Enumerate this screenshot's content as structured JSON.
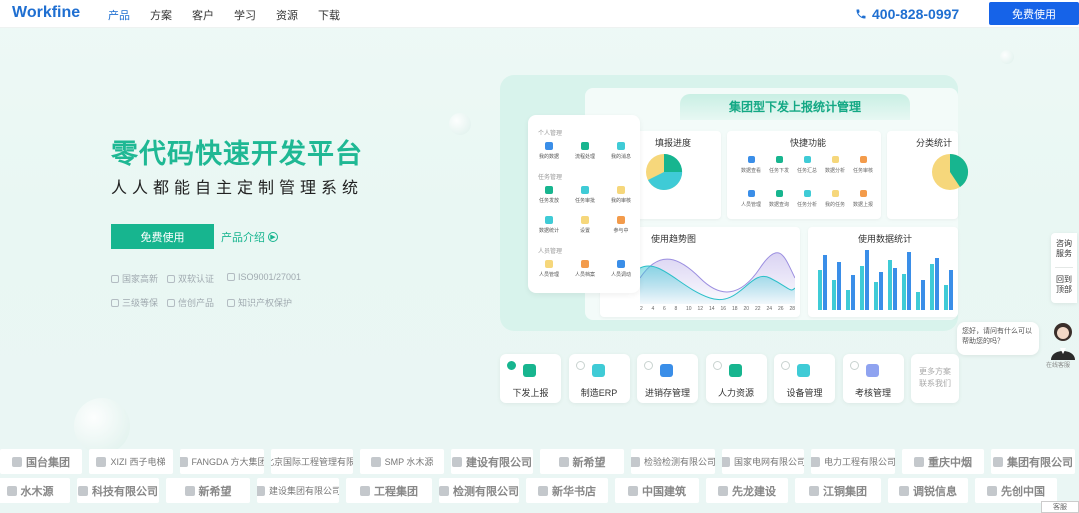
{
  "header": {
    "logo": "Workfine",
    "nav": [
      "产品",
      "方案",
      "客户",
      "学习",
      "资源",
      "下载"
    ],
    "phone": "400-828-0997",
    "trial_button": "免费使用"
  },
  "hero": {
    "title": "零代码快速开发平台",
    "subtitle": "人人都能自主定制管理系统",
    "cta_primary": "免费使用",
    "cta_secondary": "产品介绍",
    "badges": [
      "国家高新",
      "双软认证",
      "ISO9001/27001",
      "三级等保",
      "信创产品",
      "知识产权保护"
    ]
  },
  "dashboard": {
    "title": "集团型下发上报统计管理",
    "sidebar": {
      "groups": [
        {
          "title": "个人管理",
          "items": [
            "我的数据",
            "流程处理",
            "我的消息"
          ]
        },
        {
          "title": "任务管理",
          "items": [
            "任务发放",
            "任务审批",
            "我的审核"
          ]
        },
        {
          "title": "",
          "items": [
            "数据统计",
            "设置",
            "参与中"
          ]
        },
        {
          "title": "人员管理",
          "items": [
            "人员管理",
            "人员档案",
            "人员调动"
          ]
        }
      ]
    },
    "cards": {
      "top_left_title": "填报进度",
      "top_mid_title": "快捷功能",
      "top_right_title": "分类统计",
      "bottom_left_title": "使用趋势图",
      "bottom_right_title": "使用数据统计",
      "quick_items": [
        "数据查看",
        "任务下发",
        "任务汇总",
        "数据分析",
        "任务审核",
        "人员管理",
        "数据查询",
        "任务分析",
        "我的任务",
        "数据上报"
      ],
      "x_ticks": [
        "2",
        "4",
        "6",
        "8",
        "10",
        "12",
        "14",
        "16",
        "18",
        "20",
        "22",
        "24",
        "26",
        "28"
      ]
    },
    "colors": {
      "accent": "#17b58f",
      "teal": "#3fcbd6",
      "blue": "#3a8ee8",
      "yellow": "#f6d77b"
    }
  },
  "solutions": {
    "items": [
      {
        "label": "下发上报",
        "icon": "report-icon",
        "active": true
      },
      {
        "label": "制造ERP",
        "icon": "erp-icon",
        "active": false
      },
      {
        "label": "进销存管理",
        "icon": "inventory-icon",
        "active": false
      },
      {
        "label": "人力资源",
        "icon": "hr-icon",
        "active": false
      },
      {
        "label": "设备管理",
        "icon": "equipment-icon",
        "active": false
      },
      {
        "label": "考核管理",
        "icon": "assessment-icon",
        "active": false
      }
    ],
    "more": "更多方案 联系我们"
  },
  "side_float": {
    "consult": "咨询 服务",
    "top": "回到 顶部"
  },
  "chat": {
    "message": "您好，请问有什么可以帮助您的吗？",
    "agent": "在线客服"
  },
  "clients": {
    "row1": [
      "国台集团",
      "XIZI 西子电梯",
      "FANGDA 方大集团",
      "北京国际工程管理有限公司",
      "SMP 水木源",
      "建设有限公司",
      "新希望",
      "检验检测有限公司",
      "国家电网有限公司",
      "电力工程有限公司",
      "重庆中烟",
      "集团有限公司"
    ],
    "row2": [
      "水木源",
      "科技有限公司",
      "新希望",
      "建设集团有限公司",
      "工程集团",
      "检测有限公司",
      "新华书店",
      "中国建筑",
      "先龙建设",
      "江铜集团",
      "调锐信息",
      "先创中国"
    ],
    "corner": "客服"
  }
}
